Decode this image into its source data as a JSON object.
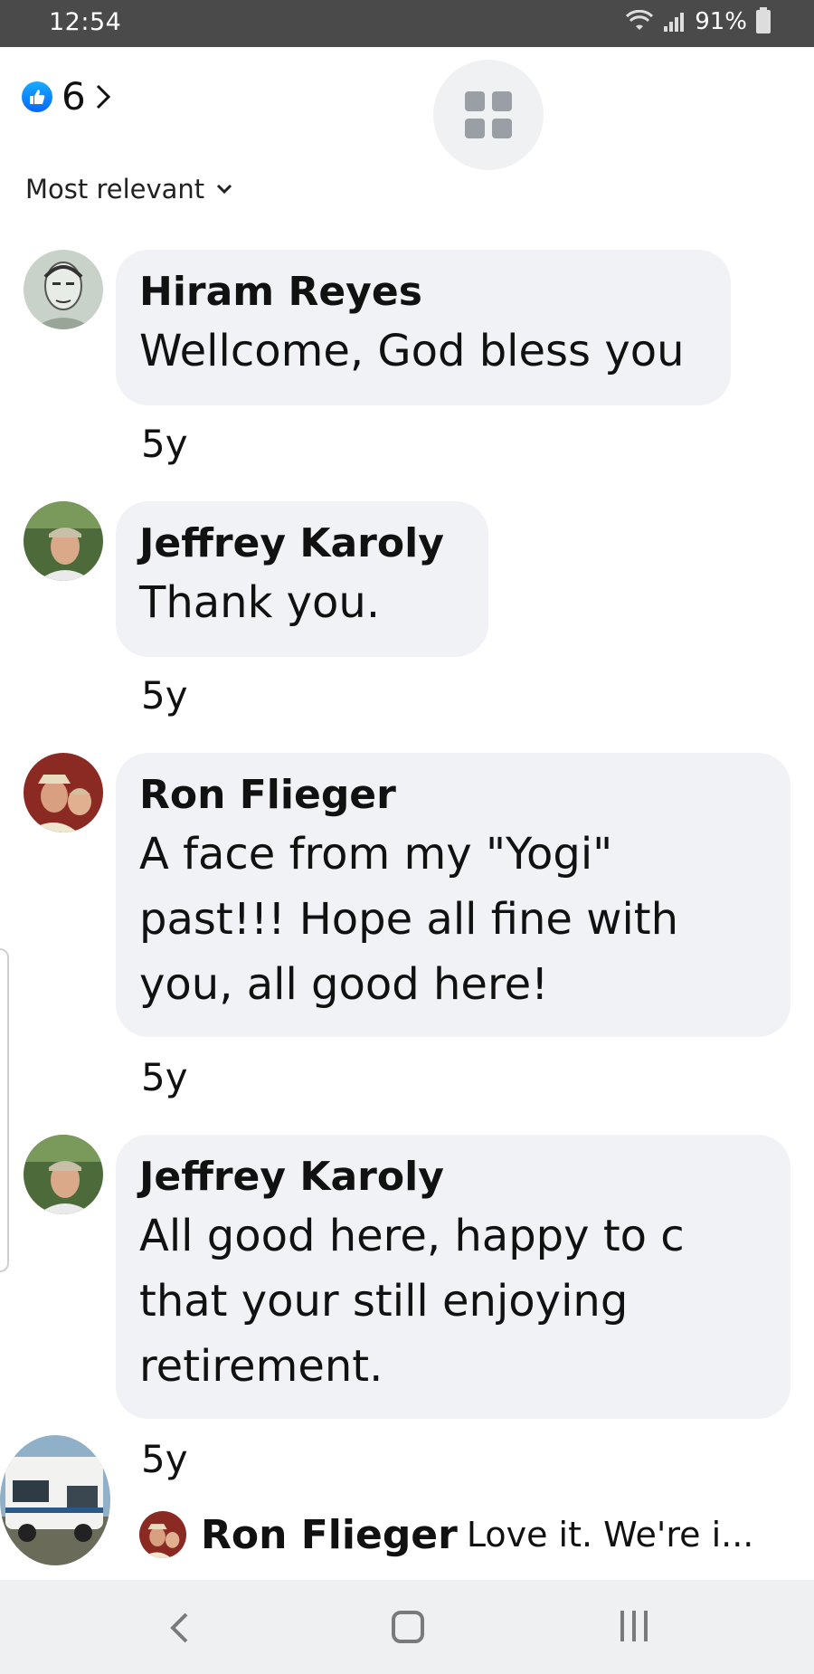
{
  "status_bar": {
    "time": "12:54",
    "battery": "91%"
  },
  "header": {
    "reaction_count": "6",
    "sort_label": "Most relevant"
  },
  "comments": [
    {
      "author": "Hiram Reyes",
      "text": "Wellcome, God bless you",
      "time": "5y"
    },
    {
      "author": "Jeffrey Karoly",
      "text": "Thank you.",
      "time": "5y"
    },
    {
      "author": "Ron Flieger",
      "text": "A face from my \"Yogi\" past!!! Hope all fine with you, all good here!",
      "time": "5y"
    },
    {
      "author": "Jeffrey Karoly",
      "text": "All good here, happy to c that your still enjoying retirement.",
      "time": "5y"
    }
  ],
  "reply_preview": {
    "author": "Ron Flieger",
    "text": "Love it. We're i..."
  },
  "icons": {
    "like": "thumbs-up-icon",
    "grid": "grid-icon",
    "back": "back-icon",
    "home": "home-icon",
    "recents": "recents-icon"
  },
  "colors": {
    "like_blue": "#1877f2",
    "bubble": "#f0f2f5",
    "status_bar": "#4a4a4a"
  }
}
